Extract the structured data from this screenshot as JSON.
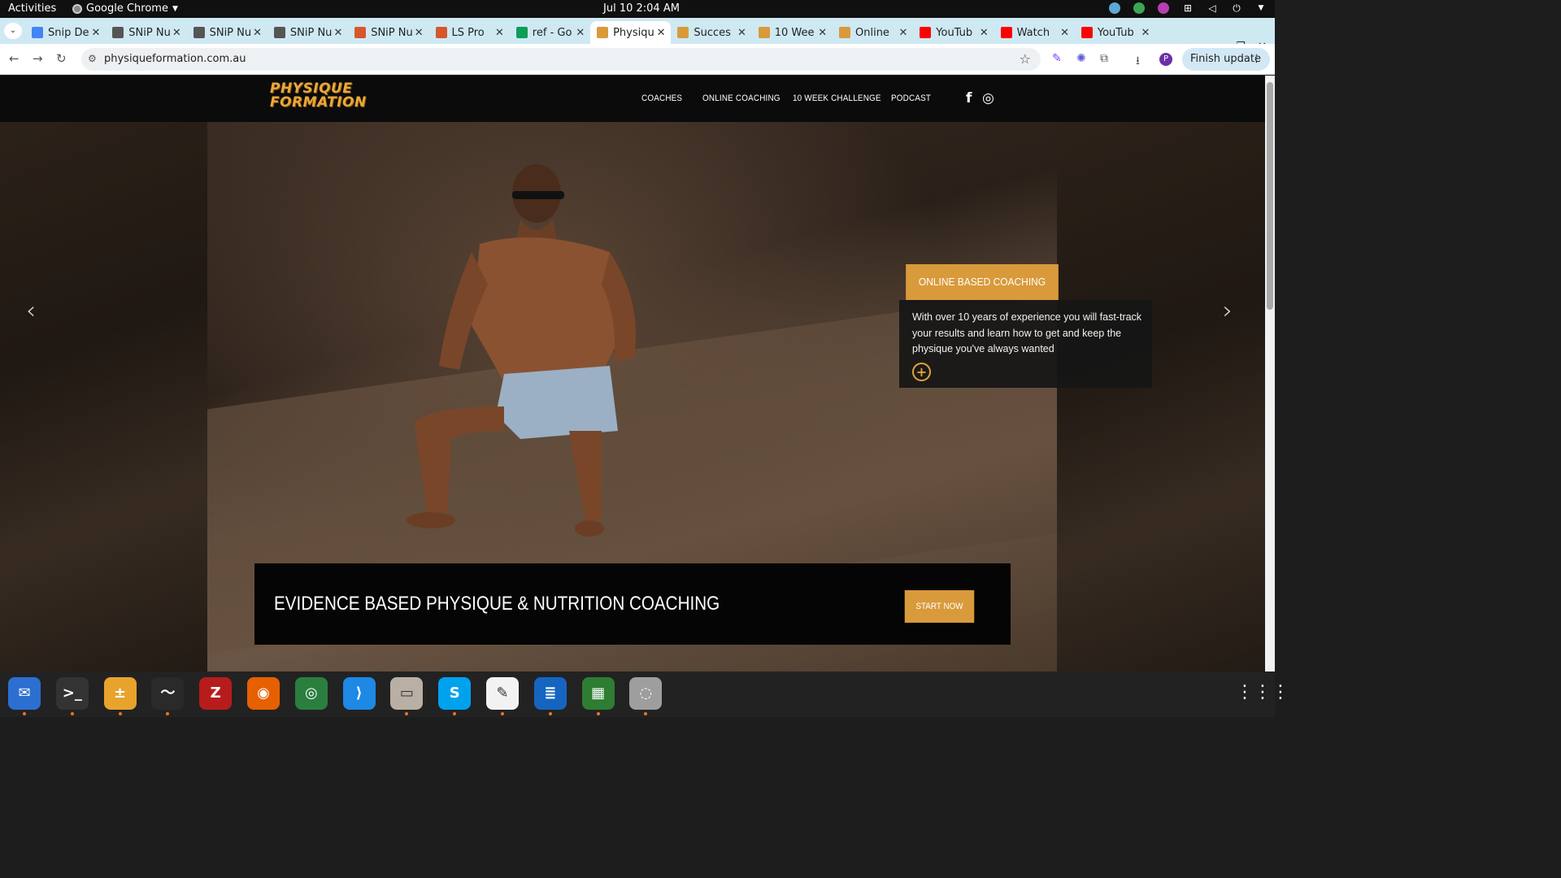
{
  "system": {
    "activities": "Activities",
    "app_name": "Google Chrome",
    "clock": "Jul 10  2:04 AM"
  },
  "browser": {
    "tabs": [
      {
        "label": "Snip De",
        "color": "#4285f4"
      },
      {
        "label": "SNiP Nu",
        "color": "#555555"
      },
      {
        "label": "SNiP Nu",
        "color": "#555555"
      },
      {
        "label": "SNiP Nu",
        "color": "#555555"
      },
      {
        "label": "SNiP Nu",
        "color": "#d6572d"
      },
      {
        "label": "LS Pro",
        "color": "#d6572d"
      },
      {
        "label": "ref - Go",
        "color": "#0f9d58"
      },
      {
        "label": "Physiqu",
        "color": "#d99a3b"
      },
      {
        "label": "Succes",
        "color": "#d99a3b"
      },
      {
        "label": "10 Wee",
        "color": "#d99a3b"
      },
      {
        "label": "Online",
        "color": "#d99a3b"
      },
      {
        "label": "YouTub",
        "color": "#ff0000"
      },
      {
        "label": "Watch",
        "color": "#ff0000"
      },
      {
        "label": "YouTub",
        "color": "#ff0000"
      }
    ],
    "active_tab_index": 7,
    "url": "physiqueformation.com.au",
    "profile_initial": "P",
    "finish_update": "Finish update"
  },
  "site": {
    "logo_line1": "PHYSIQUE",
    "logo_line2": "FORMATION",
    "nav": {
      "coaches": "COACHES",
      "online_coaching": "ONLINE COACHING",
      "challenge": "10 WEEK CHALLENGE",
      "podcast": "PODCAST"
    },
    "social": {
      "facebook": "f",
      "instagram": "◎"
    },
    "card": {
      "title": "ONLINE BASED COACHING",
      "body": "With over 10 years of experience you will fast-track your results and learn how to get and keep the physique you've always wanted",
      "plus": "+"
    },
    "cta": {
      "headline": "EVIDENCE BASED PHYSIQUE & NUTRITION COACHING",
      "button": "START NOW"
    },
    "accent_color": "#d99a3b"
  },
  "dock": {
    "items": [
      {
        "name": "thunderbird-icon",
        "glyph": "✉",
        "bg": "#2c6fd1"
      },
      {
        "name": "terminal-icon",
        "glyph": ">_",
        "bg": "#333333"
      },
      {
        "name": "calculator-icon",
        "glyph": "±",
        "bg": "#e8a32c"
      },
      {
        "name": "system-monitor-icon",
        "glyph": "〜",
        "bg": "#2a2a2a"
      },
      {
        "name": "filezilla-icon",
        "glyph": "Z",
        "bg": "#b71c1c"
      },
      {
        "name": "firefox-icon",
        "glyph": "◉",
        "bg": "#e66000"
      },
      {
        "name": "chrome-icon",
        "glyph": "◎",
        "bg": "#2a7f3f"
      },
      {
        "name": "vscode-icon",
        "glyph": "⟩",
        "bg": "#1e88e5"
      },
      {
        "name": "files-icon",
        "glyph": "▭",
        "bg": "#b8b0a4"
      },
      {
        "name": "skype-icon",
        "glyph": "S",
        "bg": "#00a2ed"
      },
      {
        "name": "text-editor-icon",
        "glyph": "✎",
        "bg": "#f2f2f2"
      },
      {
        "name": "writer-icon",
        "glyph": "≣",
        "bg": "#1565c0"
      },
      {
        "name": "calc-sheet-icon",
        "glyph": "▦",
        "bg": "#2e7d32"
      },
      {
        "name": "disk-icon",
        "glyph": "◌",
        "bg": "#9e9e9e"
      }
    ]
  }
}
